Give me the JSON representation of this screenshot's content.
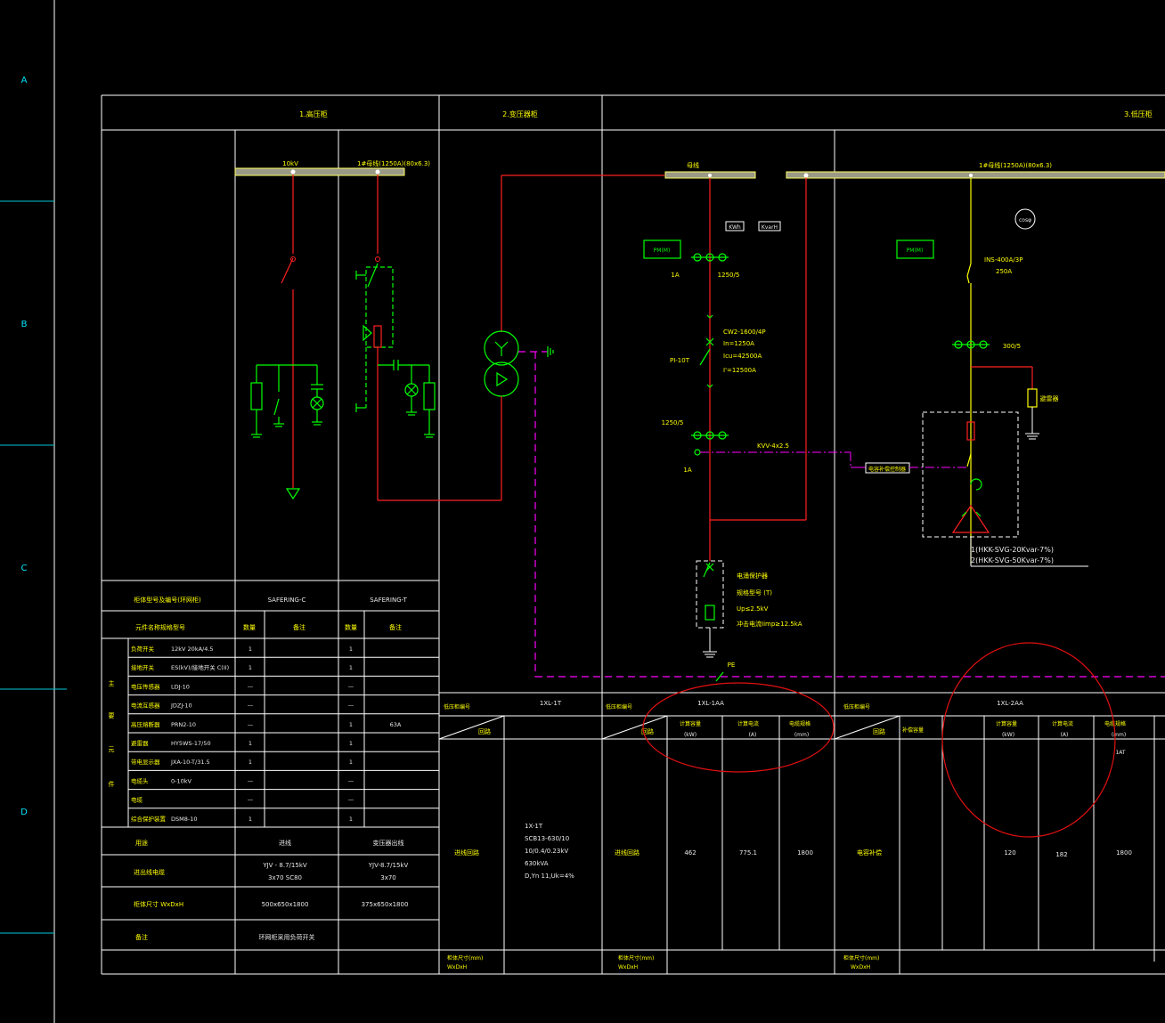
{
  "title_bar": {
    "section1": "1.高压柜",
    "section2": "2.变压器柜",
    "section3": "3.低压柜"
  },
  "border": {
    "rows": [
      "A",
      "B",
      "C",
      "D"
    ]
  },
  "busbars": {
    "hv_label_left": "10kV",
    "hv_label_right": "1#母线(1250A)(80x6.3)",
    "lv_label_left": "母线",
    "lv_label_right": "1#母线(1250A)(80x6.3)"
  },
  "lv_incoming": {
    "tags": [
      "PM(M)",
      "KWh",
      "KvarH"
    ],
    "ct_label_left": "1A",
    "ct_label_right": "1250/5",
    "breaker_lines": [
      "CW2-1600/4P",
      "In=1250A",
      "Icu=42500A",
      "I'=12500A"
    ],
    "breaker_tag": "PI-10T",
    "ct2_label": "1250/5",
    "ct2_side": "1A",
    "control_cable": "KVV-4x2.5",
    "controller_label": "电容补偿控制器",
    "spd_lines": [
      "电涌保护器",
      "规格型号 (T)",
      "Up≤2.5kV",
      "冲击电流Iimp≥12.5kA"
    ],
    "pe_label": "PE"
  },
  "lv_capacitor": {
    "tag": "PM(M)",
    "switch_lines": [
      "INS-400A/3P",
      "250A"
    ],
    "ct_label": "300/5",
    "arrester_label": "避雷器",
    "cosphi": "cosφ",
    "svg_lines": [
      "1(HKK-SVG-20Kvar-7%)",
      "2(HKK-SVG-50Kvar-7%)"
    ]
  },
  "hv_cabinets": {
    "header_model": "柜体型号及编号(环网柜)",
    "col1_name": "SAFERING-C",
    "col2_name": "SAFERING-T",
    "header_component": "元件名称规格型号",
    "sub_qty": "数量",
    "sub_remark": "备注",
    "group_label": [
      "主",
      "要",
      "元",
      "件"
    ],
    "rows": [
      {
        "name": "负荷开关",
        "spec": "12kV 20kA/4.5",
        "q1": "1",
        "r1": "",
        "q2": "1",
        "r2": ""
      },
      {
        "name": "接地开关",
        "spec": "ES(kV)/接地开关 C(II)",
        "q1": "1",
        "r1": "",
        "q2": "1",
        "r2": ""
      },
      {
        "name": "电压传感器",
        "spec": "LDJ-10",
        "q1": "—",
        "r1": "",
        "q2": "—",
        "r2": ""
      },
      {
        "name": "电流互感器",
        "spec": "JDZJ-10",
        "q1": "—",
        "r1": "",
        "q2": "—",
        "r2": ""
      },
      {
        "name": "高压熔断器",
        "spec": "PRN2-10",
        "q1": "—",
        "r1": "",
        "q2": "1",
        "r2": "63A"
      },
      {
        "name": "避雷器",
        "spec": "HY5WS-17/50",
        "q1": "1",
        "r1": "",
        "q2": "1",
        "r2": ""
      },
      {
        "name": "带电显示器",
        "spec": "JXA-10-T/31.5",
        "q1": "1",
        "r1": "",
        "q2": "1",
        "r2": ""
      },
      {
        "name": "电缆头",
        "spec": "0-10kV",
        "q1": "—",
        "r1": "",
        "q2": "—",
        "r2": ""
      },
      {
        "name": "电缆",
        "spec": "",
        "q1": "—",
        "r1": "",
        "q2": "—",
        "r2": ""
      },
      {
        "name": "综合保护装置",
        "spec": "DSM8-10",
        "q1": "1",
        "r1": "",
        "q2": "1",
        "r2": ""
      }
    ],
    "use_label": "用途",
    "use_c1": "进线",
    "use_c2": "变压器出线",
    "cable_label": "进出线电缆",
    "cable_c1_lines": [
      "YJV - 8.7/15kV",
      "3x70 SC80"
    ],
    "cable_c2_lines": [
      "YJV-8.7/15kV",
      "3x70"
    ],
    "size_label": "柜体尺寸 WxDxH",
    "size_c1": "500x650x1800",
    "size_c2": "375x650x1800",
    "note_label": "备注",
    "note_c1": "环网柜采用负荷开关"
  },
  "lv_table": {
    "panel1_label": "低压柜编号",
    "panel1_id": "1XL-1T",
    "panel1_sub": "回路",
    "panel2_label": "低压柜编号",
    "panel2_id": "1XL-1AA",
    "panel2_sub": "回路",
    "panel2_cols": [
      {
        "a": "计算容量",
        "b": "(kW)"
      },
      {
        "a": "计算电流",
        "b": "(A)"
      },
      {
        "a": "电缆规格",
        "b": "(mm)"
      }
    ],
    "panel3_label": "低压柜编号",
    "panel3_id": "1XL-2AA",
    "panel3_sub": "回路",
    "panel3_cols": [
      {
        "a": "计算容量",
        "b": "(kW)"
      },
      {
        "a": "计算电流",
        "b": "(A)"
      },
      {
        "a": "电缆规格",
        "b": "(mm)"
      }
    ],
    "panel3_extra": "补偿容量",
    "row_label1": "进线回路",
    "transformer_lines": [
      "1X-1T",
      "SCB13-630/10",
      "10/0.4/0.23kV",
      "630kVA",
      "D,Yn 11,Uk=4%"
    ],
    "row_label2": "进线回路",
    "p2_values": [
      "462",
      "775.1",
      "1800"
    ],
    "row_label3": "电容补偿",
    "p3_values": [
      "120",
      "182",
      "1800"
    ],
    "p3_top": "1AT",
    "dim_label1": "柜体尺寸(mm)",
    "dim_sub1": "WxDxH",
    "dim_label2": "柜体尺寸(mm)",
    "dim_sub2": "WxDxH",
    "dim_label3": "柜体尺寸(mm)",
    "dim_sub3": "WxDxH"
  }
}
